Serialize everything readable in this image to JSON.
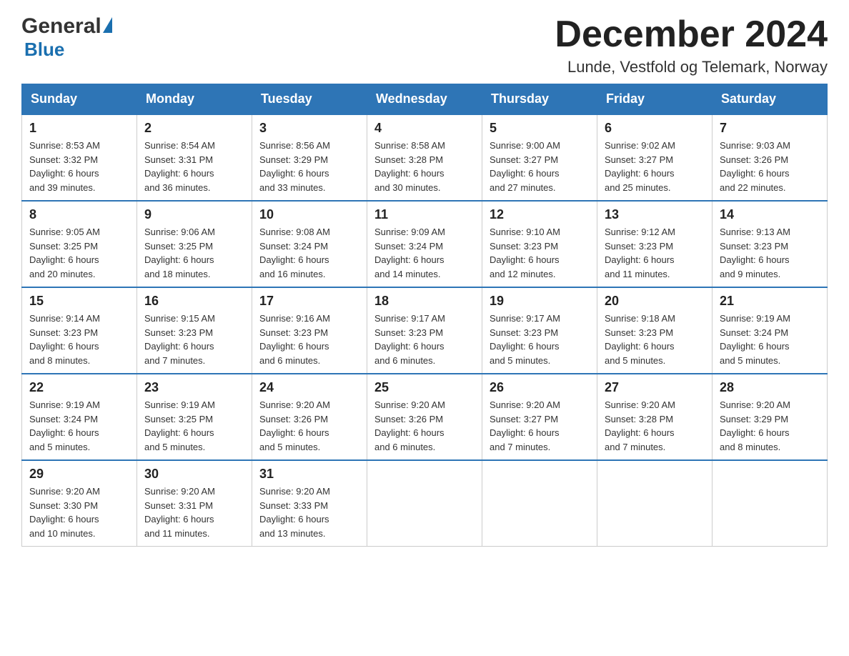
{
  "header": {
    "logo_general": "General",
    "logo_blue": "Blue",
    "title": "December 2024",
    "location": "Lunde, Vestfold og Telemark, Norway"
  },
  "days_of_week": [
    "Sunday",
    "Monday",
    "Tuesday",
    "Wednesday",
    "Thursday",
    "Friday",
    "Saturday"
  ],
  "weeks": [
    [
      {
        "day": "1",
        "sunrise": "8:53 AM",
        "sunset": "3:32 PM",
        "daylight": "6 hours and 39 minutes."
      },
      {
        "day": "2",
        "sunrise": "8:54 AM",
        "sunset": "3:31 PM",
        "daylight": "6 hours and 36 minutes."
      },
      {
        "day": "3",
        "sunrise": "8:56 AM",
        "sunset": "3:29 PM",
        "daylight": "6 hours and 33 minutes."
      },
      {
        "day": "4",
        "sunrise": "8:58 AM",
        "sunset": "3:28 PM",
        "daylight": "6 hours and 30 minutes."
      },
      {
        "day": "5",
        "sunrise": "9:00 AM",
        "sunset": "3:27 PM",
        "daylight": "6 hours and 27 minutes."
      },
      {
        "day": "6",
        "sunrise": "9:02 AM",
        "sunset": "3:27 PM",
        "daylight": "6 hours and 25 minutes."
      },
      {
        "day": "7",
        "sunrise": "9:03 AM",
        "sunset": "3:26 PM",
        "daylight": "6 hours and 22 minutes."
      }
    ],
    [
      {
        "day": "8",
        "sunrise": "9:05 AM",
        "sunset": "3:25 PM",
        "daylight": "6 hours and 20 minutes."
      },
      {
        "day": "9",
        "sunrise": "9:06 AM",
        "sunset": "3:25 PM",
        "daylight": "6 hours and 18 minutes."
      },
      {
        "day": "10",
        "sunrise": "9:08 AM",
        "sunset": "3:24 PM",
        "daylight": "6 hours and 16 minutes."
      },
      {
        "day": "11",
        "sunrise": "9:09 AM",
        "sunset": "3:24 PM",
        "daylight": "6 hours and 14 minutes."
      },
      {
        "day": "12",
        "sunrise": "9:10 AM",
        "sunset": "3:23 PM",
        "daylight": "6 hours and 12 minutes."
      },
      {
        "day": "13",
        "sunrise": "9:12 AM",
        "sunset": "3:23 PM",
        "daylight": "6 hours and 11 minutes."
      },
      {
        "day": "14",
        "sunrise": "9:13 AM",
        "sunset": "3:23 PM",
        "daylight": "6 hours and 9 minutes."
      }
    ],
    [
      {
        "day": "15",
        "sunrise": "9:14 AM",
        "sunset": "3:23 PM",
        "daylight": "6 hours and 8 minutes."
      },
      {
        "day": "16",
        "sunrise": "9:15 AM",
        "sunset": "3:23 PM",
        "daylight": "6 hours and 7 minutes."
      },
      {
        "day": "17",
        "sunrise": "9:16 AM",
        "sunset": "3:23 PM",
        "daylight": "6 hours and 6 minutes."
      },
      {
        "day": "18",
        "sunrise": "9:17 AM",
        "sunset": "3:23 PM",
        "daylight": "6 hours and 6 minutes."
      },
      {
        "day": "19",
        "sunrise": "9:17 AM",
        "sunset": "3:23 PM",
        "daylight": "6 hours and 5 minutes."
      },
      {
        "day": "20",
        "sunrise": "9:18 AM",
        "sunset": "3:23 PM",
        "daylight": "6 hours and 5 minutes."
      },
      {
        "day": "21",
        "sunrise": "9:19 AM",
        "sunset": "3:24 PM",
        "daylight": "6 hours and 5 minutes."
      }
    ],
    [
      {
        "day": "22",
        "sunrise": "9:19 AM",
        "sunset": "3:24 PM",
        "daylight": "6 hours and 5 minutes."
      },
      {
        "day": "23",
        "sunrise": "9:19 AM",
        "sunset": "3:25 PM",
        "daylight": "6 hours and 5 minutes."
      },
      {
        "day": "24",
        "sunrise": "9:20 AM",
        "sunset": "3:26 PM",
        "daylight": "6 hours and 5 minutes."
      },
      {
        "day": "25",
        "sunrise": "9:20 AM",
        "sunset": "3:26 PM",
        "daylight": "6 hours and 6 minutes."
      },
      {
        "day": "26",
        "sunrise": "9:20 AM",
        "sunset": "3:27 PM",
        "daylight": "6 hours and 7 minutes."
      },
      {
        "day": "27",
        "sunrise": "9:20 AM",
        "sunset": "3:28 PM",
        "daylight": "6 hours and 7 minutes."
      },
      {
        "day": "28",
        "sunrise": "9:20 AM",
        "sunset": "3:29 PM",
        "daylight": "6 hours and 8 minutes."
      }
    ],
    [
      {
        "day": "29",
        "sunrise": "9:20 AM",
        "sunset": "3:30 PM",
        "daylight": "6 hours and 10 minutes."
      },
      {
        "day": "30",
        "sunrise": "9:20 AM",
        "sunset": "3:31 PM",
        "daylight": "6 hours and 11 minutes."
      },
      {
        "day": "31",
        "sunrise": "9:20 AM",
        "sunset": "3:33 PM",
        "daylight": "6 hours and 13 minutes."
      },
      null,
      null,
      null,
      null
    ]
  ]
}
